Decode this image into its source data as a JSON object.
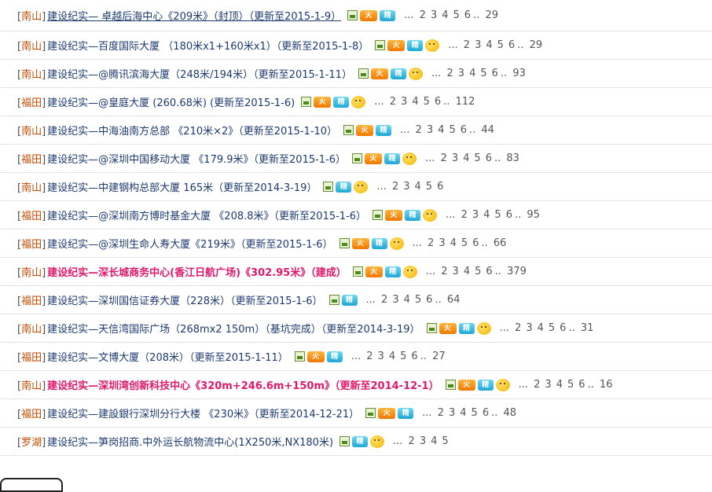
{
  "rows": [
    {
      "cat": "南山",
      "title": "建设纪实— 卓越后海中心《209米》（封顶）（更新至2015-1-9）",
      "hl": false,
      "ul": true,
      "icons": [
        "image",
        "hot",
        "jing"
      ],
      "pre_dots": "...",
      "pages": [
        "2",
        "3",
        "4",
        "5",
        "6"
      ],
      "tail": "..",
      "last": "29"
    },
    {
      "cat": "南山",
      "title": "建设纪实—百度国际大厦 （180米x1+160米x1）（更新至2015-1-8）",
      "hl": false,
      "ul": false,
      "icons": [
        "image",
        "hot",
        "jing",
        "smile"
      ],
      "pre_dots": "...",
      "pages": [
        "2",
        "3",
        "4",
        "5",
        "6"
      ],
      "tail": "..",
      "last": "29"
    },
    {
      "cat": "南山",
      "title": "建设纪实—@腾讯滨海大厦（248米/194米）（更新至2015-1-11）",
      "hl": false,
      "ul": false,
      "icons": [
        "image",
        "hot",
        "jing",
        "smile"
      ],
      "pre_dots": "...",
      "pages": [
        "2",
        "3",
        "4",
        "5",
        "6"
      ],
      "tail": "..",
      "last": "93"
    },
    {
      "cat": "福田",
      "title": "建设纪实—@皇庭大厦 (260.68米) (更新至2015-1-6)",
      "hl": false,
      "ul": false,
      "icons": [
        "image",
        "hot",
        "jing",
        "smile"
      ],
      "pre_dots": "...",
      "pages": [
        "2",
        "3",
        "4",
        "5",
        "6"
      ],
      "tail": "..",
      "last": "112"
    },
    {
      "cat": "南山",
      "title": "建设纪实—中海油南方总部 《210米×2》（更新至2015-1-10）",
      "hl": false,
      "ul": false,
      "icons": [
        "image",
        "hot",
        "jing"
      ],
      "pre_dots": "...",
      "pages": [
        "2",
        "3",
        "4",
        "5",
        "6"
      ],
      "tail": "..",
      "last": "44"
    },
    {
      "cat": "福田",
      "title": "建设纪实—@深圳中国移动大厦 《179.9米》（更新至2015-1-6）",
      "hl": false,
      "ul": false,
      "icons": [
        "image",
        "hot",
        "jing",
        "smile"
      ],
      "pre_dots": "...",
      "pages": [
        "2",
        "3",
        "4",
        "5",
        "6"
      ],
      "tail": "..",
      "last": "83"
    },
    {
      "cat": "南山",
      "title": "建设纪实—中建钢构总部大厦 165米（更新至2014-3-19）",
      "hl": false,
      "ul": false,
      "icons": [
        "image",
        "jing",
        "smile"
      ],
      "pre_dots": "...",
      "pages": [
        "2",
        "3",
        "4",
        "5",
        "6"
      ],
      "tail": "",
      "last": ""
    },
    {
      "cat": "福田",
      "title": "建设纪实—@深圳南方博时基金大厦 《208.8米》（更新至2015-1-6）",
      "hl": false,
      "ul": false,
      "icons": [
        "image",
        "hot",
        "jing",
        "smile"
      ],
      "pre_dots": "...",
      "pages": [
        "2",
        "3",
        "4",
        "5",
        "6"
      ],
      "tail": "..",
      "last": "95"
    },
    {
      "cat": "福田",
      "title": "建设纪实—@深圳生命人寿大厦《219米》（更新至2015-1-6）",
      "hl": false,
      "ul": false,
      "icons": [
        "image",
        "hot",
        "jing",
        "smile"
      ],
      "pre_dots": "...",
      "pages": [
        "2",
        "3",
        "4",
        "5",
        "6"
      ],
      "tail": "..",
      "last": "66"
    },
    {
      "cat": "南山",
      "title": "建设纪实—深长城商务中心(香江日航广场)《302.95米》（建成）",
      "hl": true,
      "ul": false,
      "icons": [
        "image",
        "hot",
        "jing",
        "smile"
      ],
      "pre_dots": "...",
      "pages": [
        "2",
        "3",
        "4",
        "5",
        "6"
      ],
      "tail": "..",
      "last": "379"
    },
    {
      "cat": "福田",
      "title": "建设纪实—深圳国信证券大厦（228米）（更新至2015-1-6）",
      "hl": false,
      "ul": false,
      "icons": [
        "image",
        "jing"
      ],
      "pre_dots": "...",
      "pages": [
        "2",
        "3",
        "4",
        "5",
        "6"
      ],
      "tail": "..",
      "last": "64"
    },
    {
      "cat": "南山",
      "title": "建设纪实—天信湾国际广场（268mx2 150m）（基坑完成）（更新至2014-3-19）",
      "hl": false,
      "ul": false,
      "icons": [
        "image",
        "hot",
        "jing",
        "smile"
      ],
      "pre_dots": "...",
      "pages": [
        "2",
        "3",
        "4",
        "5",
        "6"
      ],
      "tail": "..",
      "last": "31"
    },
    {
      "cat": "福田",
      "title": "建设纪实—文博大厦（208米）（更新至2015-1-11）",
      "hl": false,
      "ul": false,
      "icons": [
        "image",
        "hot",
        "jing"
      ],
      "pre_dots": "...",
      "pages": [
        "2",
        "3",
        "4",
        "5",
        "6"
      ],
      "tail": "..",
      "last": "27"
    },
    {
      "cat": "南山",
      "title": "建设纪实—深圳湾创新科技中心《320m+246.6m+150m》（更新至2014-12-1）",
      "hl": true,
      "ul": false,
      "icons": [
        "image",
        "hot",
        "jing",
        "smile"
      ],
      "pre_dots": "...",
      "pages": [
        "2",
        "3",
        "4",
        "5",
        "6"
      ],
      "tail": "..",
      "last": "16"
    },
    {
      "cat": "福田",
      "title": "建设纪实—建設銀行深圳分行大楼 《230米》（更新至2014-12-21）",
      "hl": false,
      "ul": false,
      "icons": [
        "image",
        "hot",
        "jing"
      ],
      "pre_dots": "...",
      "pages": [
        "2",
        "3",
        "4",
        "5",
        "6"
      ],
      "tail": "..",
      "last": "48"
    },
    {
      "cat": "罗湖",
      "title": "建设纪实—笋岗招商.中外运长航物流中心(1X250米,NX180米)",
      "hl": false,
      "ul": false,
      "icons": [
        "image",
        "jing",
        "smile"
      ],
      "pre_dots": "...",
      "pages": [
        "2",
        "3",
        "4",
        "5"
      ],
      "tail": "",
      "last": ""
    }
  ],
  "icon_text": {
    "hot": "火",
    "jing": "精"
  }
}
